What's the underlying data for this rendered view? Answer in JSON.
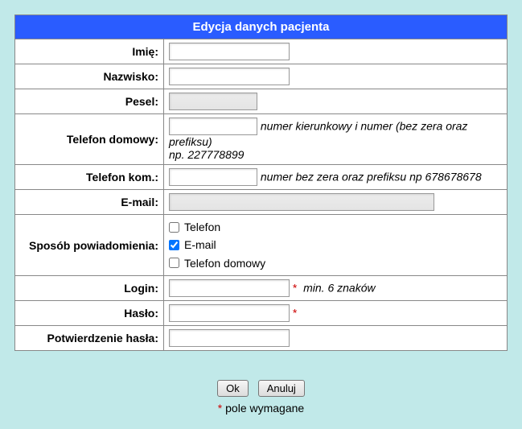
{
  "header": "Edycja danych pacjenta",
  "labels": {
    "imie": "Imię:",
    "nazwisko": "Nazwisko:",
    "pesel": "Pesel:",
    "telefon_domowy": "Telefon domowy:",
    "telefon_kom": "Telefon kom.:",
    "email": "E-mail:",
    "sposob": "Sposób powiadomienia:",
    "login": "Login:",
    "haslo": "Hasło:",
    "haslo2": "Potwierdzenie hasła:"
  },
  "hints": {
    "tel_dom1": "numer kierunkowy i numer (bez zera oraz prefiksu)",
    "tel_dom2": "np. 227778899",
    "tel_kom": "numer bez zera oraz prefiksu np 678678678",
    "login": "min. 6 znaków"
  },
  "notify": {
    "opt1": "Telefon",
    "opt2": "E-mail",
    "opt3": "Telefon domowy"
  },
  "buttons": {
    "ok": "Ok",
    "cancel": "Anuluj"
  },
  "required_mark": "*",
  "footnote": "pole wymagane"
}
